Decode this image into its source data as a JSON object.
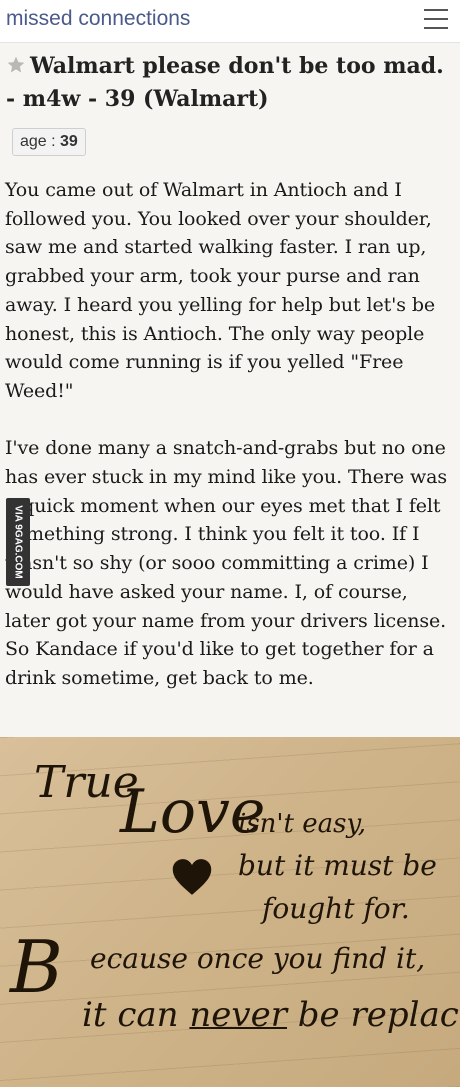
{
  "header": {
    "site_title": "missed connections",
    "menu_icon": "hamburger-menu-icon"
  },
  "post": {
    "star_icon": "star-icon",
    "title": "Walmart please don't be too mad. - m4w - 39 (Walmart)",
    "age_label": "age : ",
    "age_value": "39",
    "paragraphs": [
      "You came out of Walmart in Antioch and I followed you. You looked over your shoulder, saw me and started walking faster. I ran up, grabbed your arm, took your purse and ran away. I heard you yelling for help but let's be honest, this is Antioch. The only way people would come running is if you yelled \"Free Weed!\"",
      "I've done many a snatch-and-grabs but no one has ever stuck in my mind like you. There was a quick moment when our eyes met that I felt something strong. I think you felt it too. If I wasn't so shy (or sooo committing a crime) I would have asked your name. I, of course, later got your name from your drivers license. So Kandace if you'd like to get together for a drink sometime, get back to me."
    ]
  },
  "watermark": "VIA 9GAG.COM",
  "quote_image": {
    "line1_a": "True",
    "line1_b": "Love",
    "line1_c": "isn't easy,",
    "line2": "but it must be",
    "line3": "fought for.",
    "line4_a": "B",
    "line4_b": "ecause once you find it,",
    "line5_a": "it can ",
    "line5_b": "never",
    "line5_c": " be replaced.",
    "heart_icon": "heart-icon",
    "colors": {
      "paper": "#cfb48a",
      "ink": "#1e1408"
    }
  }
}
